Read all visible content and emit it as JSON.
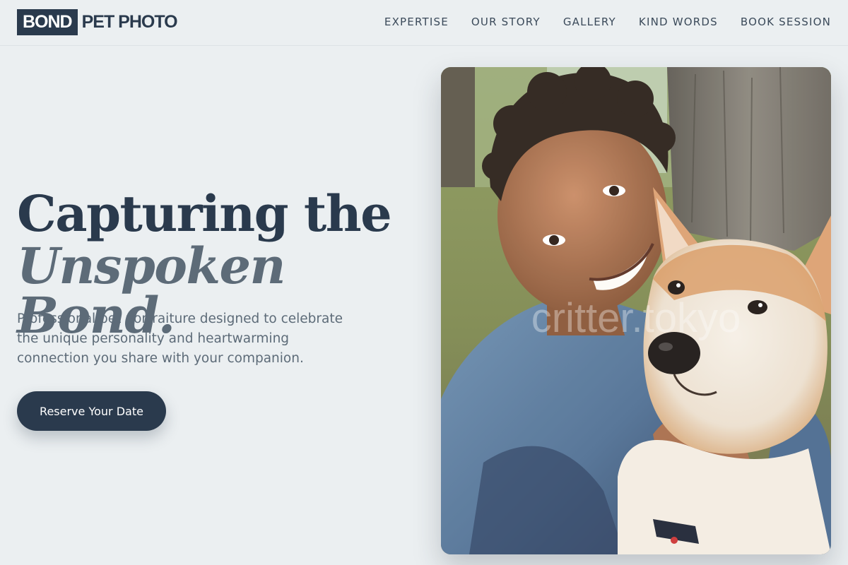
{
  "brand": {
    "box": "BOND",
    "rest": "PET PHOTO"
  },
  "nav": {
    "items": [
      {
        "label": "EXPERTISE"
      },
      {
        "label": "OUR STORY"
      },
      {
        "label": "GALLERY"
      },
      {
        "label": "KIND WORDS"
      },
      {
        "label": "BOOK SESSION"
      }
    ]
  },
  "hero": {
    "headline_line1": "Capturing the",
    "headline_line2": "Unspoken Bond.",
    "subtext": "Professional pet portraiture designed to celebrate the unique personality and heartwarming connection you share with your companion.",
    "cta_label": "Reserve Your Date"
  },
  "photo": {
    "watermark": "critter.tokyo"
  },
  "colors": {
    "background": "#ebeff1",
    "primary": "#2a3a4d",
    "muted": "#5d6b78"
  }
}
